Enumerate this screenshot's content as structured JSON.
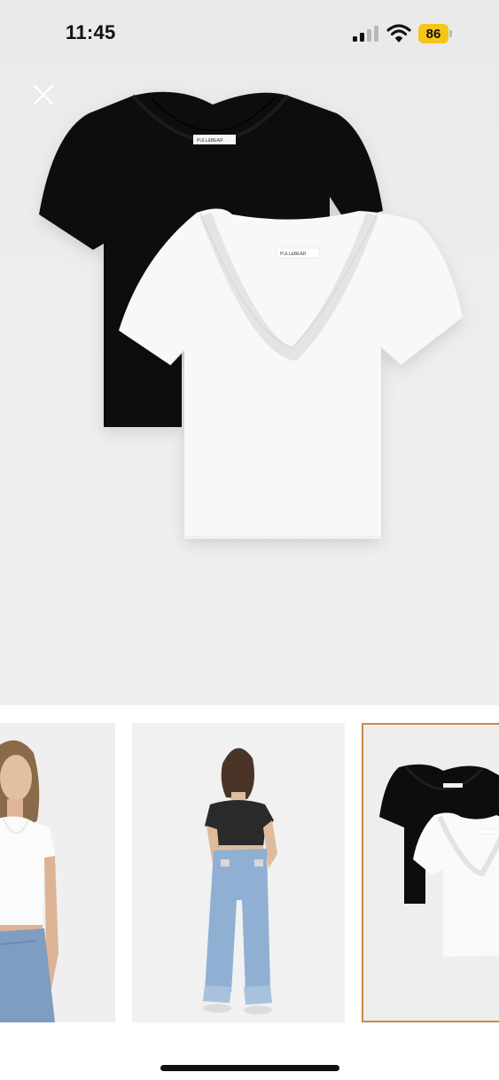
{
  "status_bar": {
    "time": "11:45",
    "battery_level": "86",
    "battery_color": "#f5c518",
    "icons": [
      "signal-icon",
      "wifi-icon",
      "battery-icon"
    ]
  },
  "viewer": {
    "close_icon": "close-icon",
    "main_image": "product-image-black-and-white-v-neck-tshirts",
    "garment_label_text": "PULL&BEAR",
    "selected_index": 3,
    "selected_border_color": "#c98a44"
  },
  "thumbnails": [
    {
      "image": "model-front-white-tshirt-jeans"
    },
    {
      "image": "model-back-black-tshirt-jeans"
    },
    {
      "image": "product-black-and-white-tshirts"
    }
  ]
}
